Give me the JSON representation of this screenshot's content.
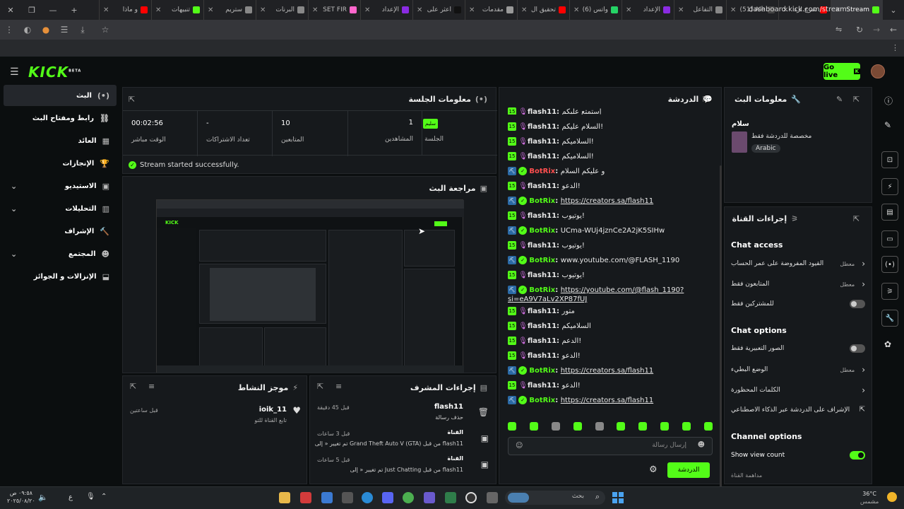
{
  "browser": {
    "tabs": [
      {
        "label": "Stream",
        "active": true,
        "color": "#53fc18"
      },
      {
        "label": "شرح لرد",
        "color": "#ff0000"
      },
      {
        "label": "(51) Ale",
        "color": "#444444"
      },
      {
        "label": "التفاعل",
        "color": "#888888"
      },
      {
        "label": "الإعداد",
        "color": "#8a2be2"
      },
      {
        "label": "(6) واتس",
        "color": "#25d366"
      },
      {
        "label": "تحقيق ال",
        "color": "#ff0000"
      },
      {
        "label": "مقدمات",
        "color": "#999999"
      },
      {
        "label": "اعثر على",
        "color": "#111111"
      },
      {
        "label": "الإعداد",
        "color": "#8a2be2"
      },
      {
        "label": "SET FIR",
        "color": "#ff66cc"
      },
      {
        "label": "البرنات",
        "color": "#888888"
      },
      {
        "label": "ستريم",
        "color": "#888888"
      },
      {
        "label": "تنبيهات",
        "color": "#53fc18"
      },
      {
        "label": "و ماذا",
        "color": "#ff0000"
      }
    ],
    "url": "dashboard.kick.com/stream"
  },
  "header": {
    "go_live": "Go live",
    "logo": "KICK",
    "logo_beta": "BETA"
  },
  "sidebar": [
    {
      "label": "البث",
      "icon": "broadcast-icon",
      "active": true
    },
    {
      "label": "رابط ومفتاح البث",
      "icon": "link-icon"
    },
    {
      "label": "العائد",
      "icon": "revenue-icon"
    },
    {
      "label": "الإنجازات",
      "icon": "trophy-icon"
    },
    {
      "label": "الاستيديو",
      "icon": "studio-icon",
      "expand": true
    },
    {
      "label": "التحليلات",
      "icon": "analytics-icon",
      "expand": true
    },
    {
      "label": "الإشراف",
      "icon": "moderation-icon"
    },
    {
      "label": "المجتمع",
      "icon": "community-icon",
      "expand": true
    },
    {
      "label": "الإنزالات و الجوائز",
      "icon": "drops-icon"
    }
  ],
  "session": {
    "title": "معلومات الجلسة",
    "badge": "سليم",
    "session_label": "الجلسة",
    "viewers_value": "1",
    "viewers_label": "المشاهدين",
    "followers_value": "10",
    "followers_label": "المتابعين",
    "subs_value": "-",
    "subs_label": "تعداد الاشتراكات",
    "live_value": "00:02:56",
    "live_label": "الوقت مباشر",
    "status": "Stream started successfully."
  },
  "preview": {
    "title": "مراجعة البث"
  },
  "activity": {
    "title": "موجز النشاط",
    "user": "ioik_11",
    "action": "تابع القناة للتو",
    "time": "قبل ساعتين"
  },
  "mod_actions": {
    "title": "إجراءات المشرف",
    "items": [
      {
        "user": "flash11",
        "desc": "حذف رسالة",
        "time": "قبل 45 دقيقة"
      },
      {
        "user": "القناة",
        "desc": "تم تغيير « إلى Grand Theft Auto V (GTA) من قبل flash11",
        "time": "قبل 3 ساعات"
      },
      {
        "user": "القناة",
        "desc": "تم تغيير « إلى Just Chatting من قبل flash11",
        "time": "قبل 5 ساعات"
      }
    ]
  },
  "chat": {
    "title": "الدردشة",
    "placeholder": "إرسال رسالة",
    "send": "الدردشة",
    "messages": [
      {
        "user": "flash11",
        "text": "إستمتع عليكم",
        "type": "user"
      },
      {
        "user": "flash11",
        "text": "السلام عليكم!",
        "type": "user"
      },
      {
        "user": "flash11",
        "text": "السلاميكم!",
        "type": "user"
      },
      {
        "user": "flash11",
        "text": "السلاميكم!",
        "type": "user"
      },
      {
        "user": "BotRix",
        "text": "و عليكم السلام",
        "type": "botred"
      },
      {
        "user": "flash11",
        "text": "الدعو!",
        "type": "user"
      },
      {
        "user": "BotRix",
        "text": "https://creators.sa/flash11",
        "type": "bot",
        "link": true
      },
      {
        "user": "flash11",
        "text": "يوتيوب!",
        "type": "user"
      },
      {
        "user": "BotRix",
        "text": "UCma-WUj4jznCe2A2jK5SIHw",
        "type": "bot"
      },
      {
        "user": "flash11",
        "text": "يوتيوب!",
        "type": "user"
      },
      {
        "user": "BotRix",
        "text": "www.youtube.com/@FLASH_1190",
        "type": "bot"
      },
      {
        "user": "flash11",
        "text": "يوتيوب!",
        "type": "user"
      },
      {
        "user": "BotRix",
        "text": "https://youtube.com/@flash_1190?si=eA9V7aLv2XP87fUJ",
        "type": "bot",
        "link": true
      },
      {
        "user": "flash11",
        "text": "متور",
        "type": "user"
      },
      {
        "user": "flash11",
        "text": "السلاميكم",
        "type": "user"
      },
      {
        "user": "flash11",
        "text": "الدعم!",
        "type": "user"
      },
      {
        "user": "flash11",
        "text": "الدعو!",
        "type": "user"
      },
      {
        "user": "BotRix",
        "text": "https://creators.sa/flash11",
        "type": "bot",
        "link": true
      },
      {
        "user": "flash11",
        "text": "الدعو!",
        "type": "user"
      },
      {
        "user": "BotRix",
        "text": "https://creators.sa/flash11",
        "type": "bot",
        "link": true
      }
    ]
  },
  "stream_info": {
    "title": "معلومات البث",
    "stream_title": "سلام",
    "category": "مخصصة للدردشة فقط",
    "tag": "Arabic"
  },
  "channel_actions": {
    "title": "إجراءات القناة",
    "chat_access": "Chat access",
    "access_items": [
      {
        "label": "القيود المفروضة على عمر الحساب",
        "value": "معطل",
        "kind": "nav"
      },
      {
        "label": "المتابعون فقط",
        "value": "معطل",
        "kind": "nav"
      },
      {
        "label": "للمشتركين فقط",
        "kind": "toggle",
        "on": false
      }
    ],
    "chat_options": "Chat options",
    "option_items": [
      {
        "label": "الصور التعبيرية فقط",
        "kind": "toggle",
        "on": false
      },
      {
        "label": "الوضع البطيء",
        "value": "معطل",
        "kind": "nav"
      },
      {
        "label": "الكلمات المحظورة",
        "kind": "nav"
      },
      {
        "label": "الإشراف على الدردشة عبر الذكاء الاصطناعي",
        "kind": "ext"
      }
    ],
    "channel_options": "Channel options",
    "show_view_count": "Show view count",
    "more": "مداهمة القناة"
  },
  "taskbar": {
    "search": "بحث",
    "time": "٠٩:٥٨ ص",
    "date": "٢٠٢٥/٠٨/٢٠",
    "temp": "36°C",
    "weather": "مشمس",
    "lang": "ع"
  },
  "colors": {
    "accent": "#53fc18",
    "bg": "#0b0e0f",
    "panel": "#16191c"
  }
}
